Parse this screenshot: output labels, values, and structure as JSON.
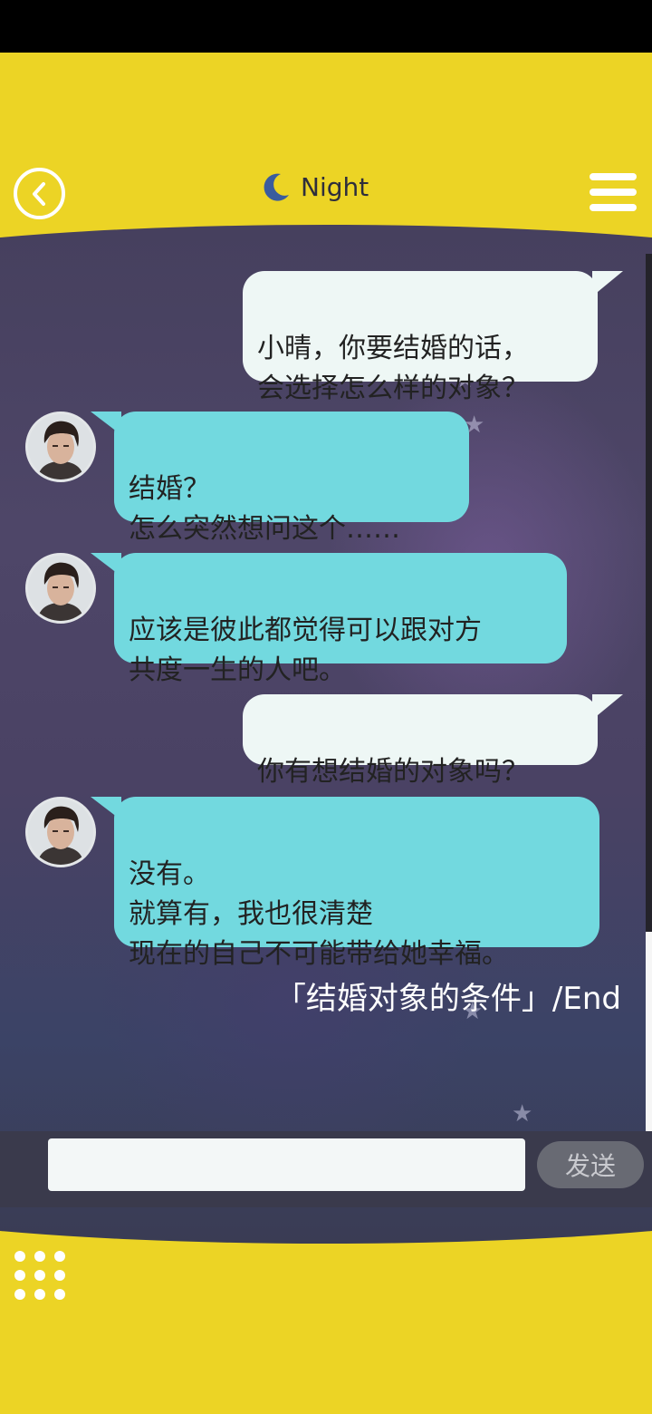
{
  "header": {
    "back_icon": "chevron-left-icon",
    "moon_icon": "crescent-moon-icon",
    "title": "Night",
    "menu_icon": "hamburger-menu-icon"
  },
  "messages": [
    {
      "side": "out",
      "text": "小晴，你要结婚的话，\n会选择怎么样的对象？"
    },
    {
      "side": "in",
      "text": "结婚？\n怎么突然想问这个……"
    },
    {
      "side": "in",
      "text": "应该是彼此都觉得可以跟对方\n共度一生的人吧。"
    },
    {
      "side": "out",
      "text": "你有想结婚的对象吗？"
    },
    {
      "side": "in",
      "text": "没有。\n就算有，我也很清楚\n现在的自己不可能带给她幸福。"
    }
  ],
  "end_label": "「结婚对象的条件」/End",
  "input": {
    "value": "",
    "placeholder": ""
  },
  "send_label": "发送",
  "grid_icon": "grid-dots-icon",
  "colors": {
    "frame": "#ecd425",
    "bubble_in": "#72d9df",
    "bubble_out": "#eef7f5",
    "input_bar": "#3a3a4c",
    "send_button": "#686a73"
  }
}
